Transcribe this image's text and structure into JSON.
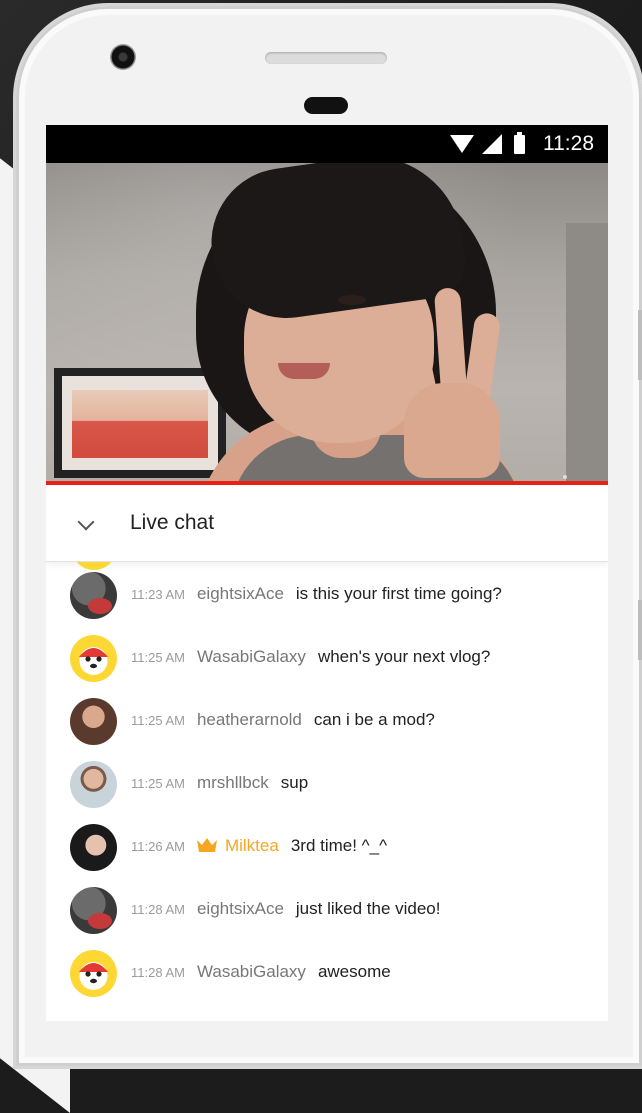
{
  "status_bar": {
    "time": "11:28"
  },
  "colors": {
    "accent_red": "#e62117",
    "owner_gold": "#f5a623",
    "video_progress_fraction": 1.0
  },
  "chat": {
    "title": "Live chat",
    "messages": [
      {
        "time": "11:23 AM",
        "author": "eightsixAce",
        "text": "is this your first time going?",
        "avatar": "helmet-avatar",
        "is_owner": false
      },
      {
        "time": "11:25 AM",
        "author": "WasabiGalaxy",
        "text": "when's your next vlog?",
        "avatar": "wasabi-avatar",
        "is_owner": false
      },
      {
        "time": "11:25 AM",
        "author": "heatherarnold",
        "text": "can i be a mod?",
        "avatar": "heather-avatar",
        "is_owner": false
      },
      {
        "time": "11:25 AM",
        "author": "mrshllbck",
        "text": "sup",
        "avatar": "mrsh-avatar",
        "is_owner": false
      },
      {
        "time": "11:26 AM",
        "author": "Milktea",
        "text": "3rd time! ^_^",
        "avatar": "milk-avatar",
        "is_owner": true
      },
      {
        "time": "11:28 AM",
        "author": "eightsixAce",
        "text": "just liked the video!",
        "avatar": "helmet-avatar",
        "is_owner": false
      },
      {
        "time": "11:28 AM",
        "author": "WasabiGalaxy",
        "text": "awesome",
        "avatar": "wasabi-avatar",
        "is_owner": false
      }
    ]
  }
}
